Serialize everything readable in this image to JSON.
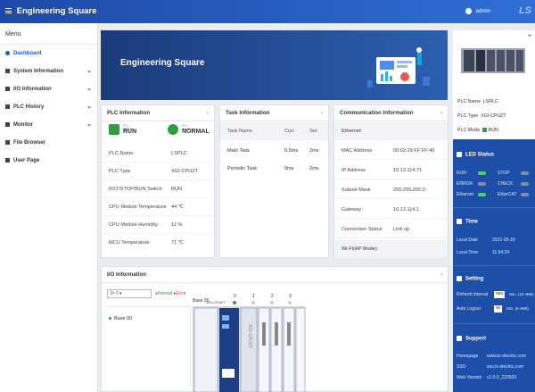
{
  "topbar": {
    "title": "Engineering Square",
    "user": "admin",
    "logo": "LS"
  },
  "sidebar": {
    "menu_label": "Menu",
    "items": [
      {
        "label": "Dashboard",
        "icon": "home-icon",
        "active": true,
        "expandable": false
      },
      {
        "label": "System Information",
        "icon": "gear-icon",
        "expandable": true
      },
      {
        "label": "I/O Information",
        "icon": "io-icon",
        "expandable": true
      },
      {
        "label": "PLC History",
        "icon": "history-icon",
        "expandable": true
      },
      {
        "label": "Monitor",
        "icon": "monitor-icon",
        "expandable": true
      },
      {
        "label": "File Browser",
        "icon": "folder-icon",
        "expandable": false
      },
      {
        "label": "User Page",
        "icon": "user-icon",
        "expandable": false
      }
    ]
  },
  "hero": {
    "title": "Engineering Square"
  },
  "plc_info": {
    "title": "PLC Information",
    "mode_small": "PLC MODE",
    "mode_value": "RUN",
    "state_small": "PLC STATE",
    "state_value": "NORMAL",
    "rows": [
      {
        "k": "PLC Name",
        "v": "LSPLC"
      },
      {
        "k": "PLC Type",
        "v": "XGI-CPUZT"
      },
      {
        "k": "RST/STOP/RUN Switch",
        "v": "RUN"
      },
      {
        "k": "CPU Module Temperature",
        "v": "44 ℃"
      },
      {
        "k": "CPU Module Humidity",
        "v": "11 %"
      },
      {
        "k": "MCU Temperature",
        "v": "71 ℃"
      }
    ]
  },
  "task_info": {
    "title": "Task Information",
    "headers": [
      "Task Name",
      "Curr.",
      "Set"
    ],
    "rows": [
      [
        "Main Task",
        "0.5ms",
        "2ms"
      ],
      [
        "Periodic Task",
        "0ms",
        "2ms"
      ]
    ]
  },
  "comm_info": {
    "title": "Communication Information",
    "section": "Ethernet",
    "rows": [
      {
        "k": "MAC Address",
        "v": "00:02:29:FF:FF:40"
      },
      {
        "k": "IP Address",
        "v": "10.13.114.71"
      },
      {
        "k": "Subnet Mask",
        "v": "255.255.255.0"
      },
      {
        "k": "Gateway",
        "v": "10.13.114.1"
      },
      {
        "k": "Connection Status",
        "v": "Link up"
      }
    ],
    "wifi": "Wi-Fi(AP Mode)"
  },
  "io_info": {
    "title": "I/O Information",
    "select": "0~7",
    "legend_normal": "●Normal",
    "legend_error": "●Error",
    "tree_item": "Base 00",
    "base_label": "Base 00",
    "cpu_label": "XGI-CPUZT",
    "slots": [
      "0",
      "1",
      "2",
      "3"
    ]
  },
  "right_panel": {
    "plc_name_label": "PLC Name",
    "plc_name": "LSPLC",
    "plc_type_label": "PLC Type",
    "plc_type": "XGI-CPUZT",
    "plc_mode_label": "PLC Mode",
    "plc_mode": "RUN",
    "led_title": "LED Status",
    "leds": [
      {
        "label": "RUN",
        "color": "#4cd15a"
      },
      {
        "label": "STOP",
        "color": "#7f8fa8"
      },
      {
        "label": "ERROR",
        "color": "#7f8fa8"
      },
      {
        "label": "CHECK",
        "color": "#7f8fa8"
      },
      {
        "label": "Ethernet",
        "color": "#4cd15a"
      },
      {
        "label": "EtherCAT",
        "color": "#7f8fa8"
      }
    ],
    "time_title": "Time",
    "local_date_label": "Local Date",
    "local_date": "2022-05-16",
    "local_time_label": "Local Time",
    "local_time": "11:54:24",
    "setting_title": "Setting",
    "refresh_label": "Refresh Interval",
    "refresh_value": "999",
    "refresh_unit": "Sec. (10~999)",
    "logout_label": "Auto Logout",
    "logout_value": "60",
    "logout_unit": "Min. (5~999)",
    "support_title": "Support",
    "homepage_label": "Homepage",
    "homepage": "www.ls-electric.com",
    "sso_label": "SSO",
    "sso": "sso.ls-electric.com",
    "webver_label": "Web Version",
    "webver": "v1.0.0_220503"
  },
  "colors": {
    "brand_blue": "#1e4fa8",
    "ok_green": "#2f9e41"
  }
}
